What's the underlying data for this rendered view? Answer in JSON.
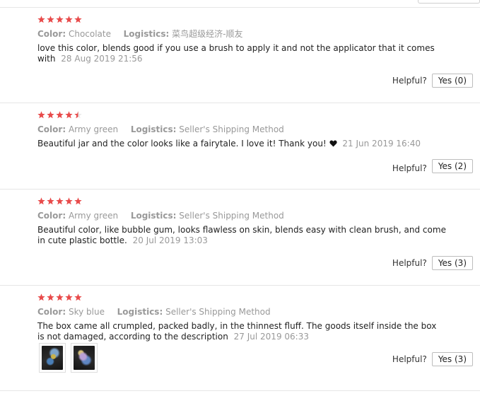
{
  "accent_color": "#e84a4a",
  "helpful_label": "Helpful?",
  "reviews": [
    {
      "rating": 5,
      "color_label": "Color:",
      "color_value": "Chocolate",
      "logistics_label": "Logistics:",
      "logistics_value": "菜鸟超级经济-顺友",
      "text": "love this color, blends good if you use a brush to apply it and not the applicator that it comes with",
      "date": "28 Aug 2019 21:56",
      "heart": false,
      "yes_label": "Yes (0)",
      "images": []
    },
    {
      "rating": 4.5,
      "color_label": "Color:",
      "color_value": "Army green",
      "logistics_label": "Logistics:",
      "logistics_value": "Seller's Shipping Method",
      "text": "Beautiful jar and the color looks like a fairytale. I love it! Thank you!",
      "date": "21 Jun 2019 16:40",
      "heart": true,
      "heart_icon": "heart-icon",
      "yes_label": "Yes (2)",
      "images": []
    },
    {
      "rating": 5,
      "color_label": "Color:",
      "color_value": "Army green",
      "logistics_label": "Logistics:",
      "logistics_value": "Seller's Shipping Method",
      "text": "Beautiful color, like bubble gum, looks flawless on skin, blends easy with clean brush, and come in cute plastic bottle.",
      "date": "20 Jul 2019 13:03",
      "heart": false,
      "yes_label": "Yes (3)",
      "images": []
    },
    {
      "rating": 5,
      "color_label": "Color:",
      "color_value": "Sky blue",
      "logistics_label": "Logistics:",
      "logistics_value": "Seller's Shipping Method",
      "text": "The box came all crumpled, packed badly, in the thinnest fluff. The goods itself inside the box is not damaged, according to the description",
      "date": "27 Jul 2019 06:33",
      "heart": false,
      "yes_label": "Yes (3)",
      "images": [
        "review-photo-1",
        "review-photo-2"
      ]
    }
  ]
}
